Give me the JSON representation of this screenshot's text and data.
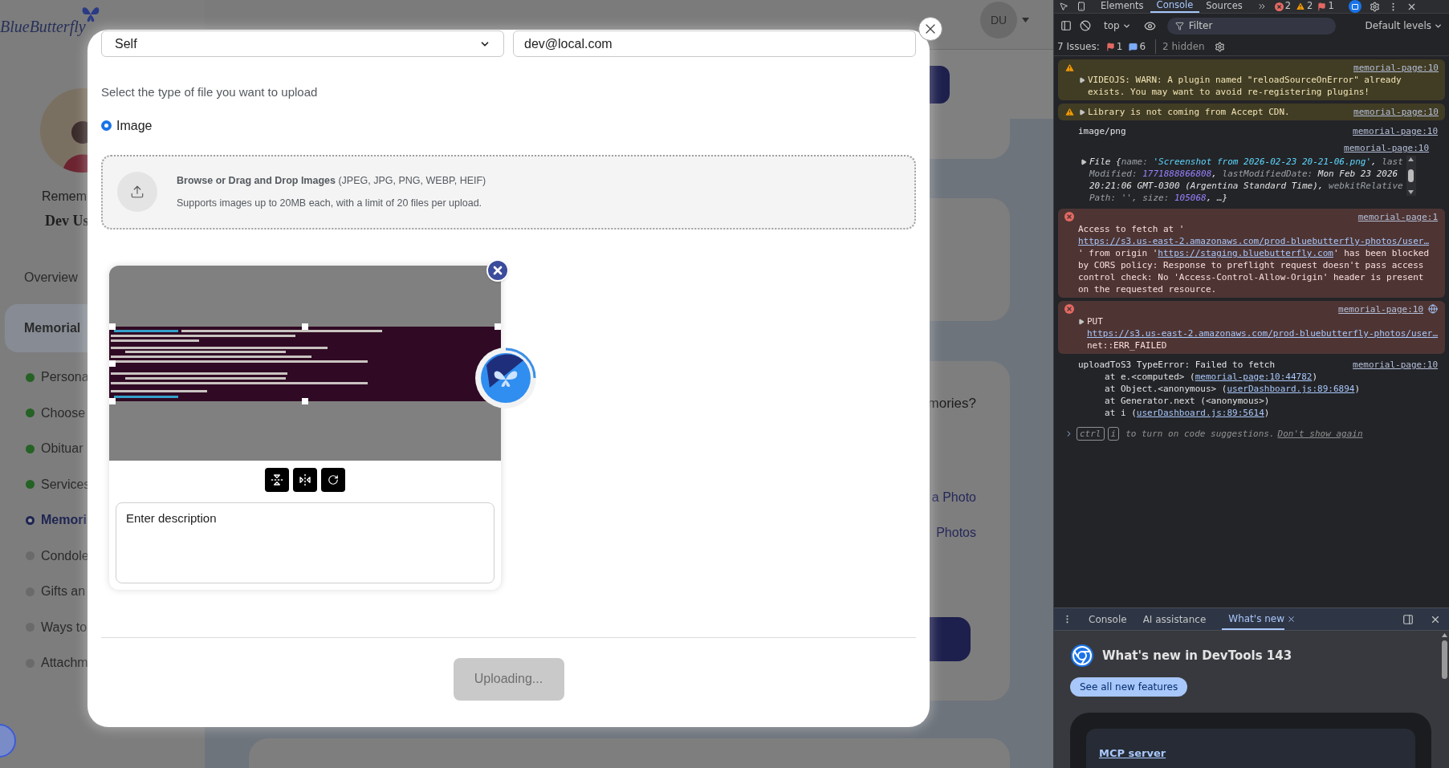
{
  "background_page": {
    "logo": "BlueButterfly",
    "profile": {
      "caption": "Remem",
      "name": "Dev Us"
    },
    "nav": [
      {
        "label": "Overview",
        "selected": false
      },
      {
        "label": "Memorial",
        "selected": true
      }
    ],
    "steps": [
      {
        "label": "Persona",
        "kind": "done"
      },
      {
        "label": "Choose",
        "kind": "done"
      },
      {
        "label": "Obituar",
        "kind": "done"
      },
      {
        "label": "Services",
        "kind": "done"
      },
      {
        "label": "Memori",
        "kind": "current"
      },
      {
        "label": "Condole",
        "kind": "pending"
      },
      {
        "label": "Gifts an",
        "kind": "pending"
      },
      {
        "label": "Ways to",
        "kind": "pending"
      },
      {
        "label": "Attachm",
        "kind": "pending"
      }
    ],
    "header": {
      "avatar_initials": "DU"
    },
    "content": {
      "question": "mories?",
      "options": [
        "a Photo",
        "Photos"
      ]
    }
  },
  "modal": {
    "relationship_select": {
      "value": "Self"
    },
    "email_field": {
      "value": "dev@local.com"
    },
    "file_type_prompt": "Select the type of file you want to upload",
    "file_types": [
      {
        "label": "Image",
        "selected": true
      }
    ],
    "dropzone": {
      "title": "Browse or Drag and Drop Images",
      "formats": "(JPEG, JPG, PNG, WEBP, HEIF)",
      "note": "Supports images up to 20MB each, with a limit of 20 files per upload."
    },
    "uploads": [
      {
        "placeholder": "Enter description",
        "loading": true
      }
    ],
    "submit_button": {
      "label": "Uploading...",
      "disabled": true
    }
  },
  "devtools": {
    "tabs": [
      {
        "label": "Elements",
        "selected": false
      },
      {
        "label": "Console",
        "selected": true
      },
      {
        "label": "Sources",
        "selected": false
      }
    ],
    "counts": [
      {
        "kind": "error",
        "count": "2"
      },
      {
        "kind": "warning",
        "count": "2"
      },
      {
        "kind": "issue",
        "count": "1"
      }
    ],
    "toolbar": {
      "context": "top",
      "filter_placeholder": "Filter",
      "levels": "Default levels"
    },
    "issues": {
      "label": "7 Issues:",
      "counts": [
        {
          "kind": "issue",
          "count": "1"
        },
        {
          "kind": "info",
          "count": "6"
        }
      ],
      "hidden": "2 hidden"
    },
    "messages": [
      {
        "kind": "warning",
        "expandable": true,
        "source": "memorial-page:10",
        "parts": [
          {
            "kind": "plain",
            "text": "VIDEOJS: WARN: A plugin named \"reloadSourceOnError\" already exists. You may want to avoid re-registering plugins!"
          }
        ]
      },
      {
        "kind": "warning",
        "expandable": true,
        "source": "memorial-page:10",
        "parts": [
          {
            "kind": "plain",
            "text": "Library is not coming from Accept CDN."
          }
        ]
      },
      {
        "kind": "log",
        "expandable": false,
        "source": "memorial-page:10",
        "parts": [
          {
            "kind": "plain",
            "text": "image/png"
          }
        ]
      },
      {
        "kind": "object",
        "expandable": true,
        "source": "memorial-page:10",
        "parts": [
          {
            "kind": "plain",
            "text": "File {"
          },
          {
            "kind": "key",
            "text": "name: "
          },
          {
            "kind": "string",
            "text": "'Screenshot from 2026-02-23 20-21-06.png'"
          },
          {
            "kind": "plain",
            "text": ", "
          },
          {
            "kind": "key",
            "text": "lastModified: "
          },
          {
            "kind": "number",
            "text": "1771888866808"
          },
          {
            "kind": "plain",
            "text": ", "
          },
          {
            "kind": "key",
            "text": "lastModifiedDate: "
          },
          {
            "kind": "plain",
            "text": "Mon Feb 23 2026 20:21:06 GMT-0300 (Argentina Standard Time), "
          },
          {
            "kind": "key",
            "text": "webkitRelativePath: "
          },
          {
            "kind": "key",
            "text": "'', "
          },
          {
            "kind": "key",
            "text": "size: "
          },
          {
            "kind": "number",
            "text": "105068"
          },
          {
            "kind": "plain",
            "text": ", …}"
          }
        ]
      },
      {
        "kind": "error",
        "expandable": false,
        "source": "memorial-page:1",
        "parts": [
          {
            "kind": "plain",
            "text": "Access to fetch at '"
          },
          {
            "kind": "url_line",
            "text": "https://s3.us-east-2.amazonaws.com/prod-bluebutterfly-photos/user…"
          },
          {
            "kind": "plain",
            "text": "' from origin '"
          },
          {
            "kind": "link",
            "text": "https://staging.bluebutterfly.com"
          },
          {
            "kind": "plain",
            "text": "' has been blocked by CORS policy: Response to preflight request doesn't pass access control check: No 'Access-Control-Allow-Origin' header is present on the requested resource."
          }
        ]
      },
      {
        "kind": "error",
        "expandable": true,
        "network": true,
        "source": "memorial-page:10",
        "parts": [
          {
            "kind": "plain",
            "text": "PUT"
          },
          {
            "kind": "url_line",
            "text": "https://s3.us-east-2.amazonaws.com/prod-bluebutterfly-photos/user…"
          },
          {
            "kind": "plain",
            "text": "net::ERR_FAILED"
          }
        ]
      },
      {
        "kind": "log",
        "expandable": false,
        "source": "memorial-page:10",
        "parts": [
          {
            "kind": "plain",
            "text": "uploadToS3 TypeError: Failed to fetch"
          }
        ],
        "stack": [
          [
            {
              "kind": "plain",
              "text": "at e.<computed> ("
            },
            {
              "kind": "link",
              "text": "memorial-page:10:44782"
            },
            {
              "kind": "plain",
              "text": ")"
            }
          ],
          [
            {
              "kind": "plain",
              "text": "at Object.<anonymous> ("
            },
            {
              "kind": "link",
              "text": "userDashboard.js:89:6894"
            },
            {
              "kind": "plain",
              "text": ")"
            }
          ],
          [
            {
              "kind": "plain",
              "text": "at Generator.next (<anonymous>)"
            }
          ],
          [
            {
              "kind": "plain",
              "text": "at i ("
            },
            {
              "kind": "link",
              "text": "userDashboard.js:89:5614"
            },
            {
              "kind": "plain",
              "text": ")"
            }
          ]
        ]
      }
    ],
    "prompt": {
      "keys": [
        "ctrl",
        "i"
      ],
      "text": "to turn on code suggestions.",
      "link": "Don't show again"
    },
    "drawer": {
      "tabs": [
        {
          "label": "Console",
          "selected": false,
          "closable": false
        },
        {
          "label": "AI assistance",
          "selected": false,
          "closable": false
        },
        {
          "label": "What's new",
          "selected": true,
          "closable": true
        }
      ],
      "title": "What's new in DevTools 143",
      "button": "See all new features",
      "feature_link": "MCP server"
    }
  }
}
